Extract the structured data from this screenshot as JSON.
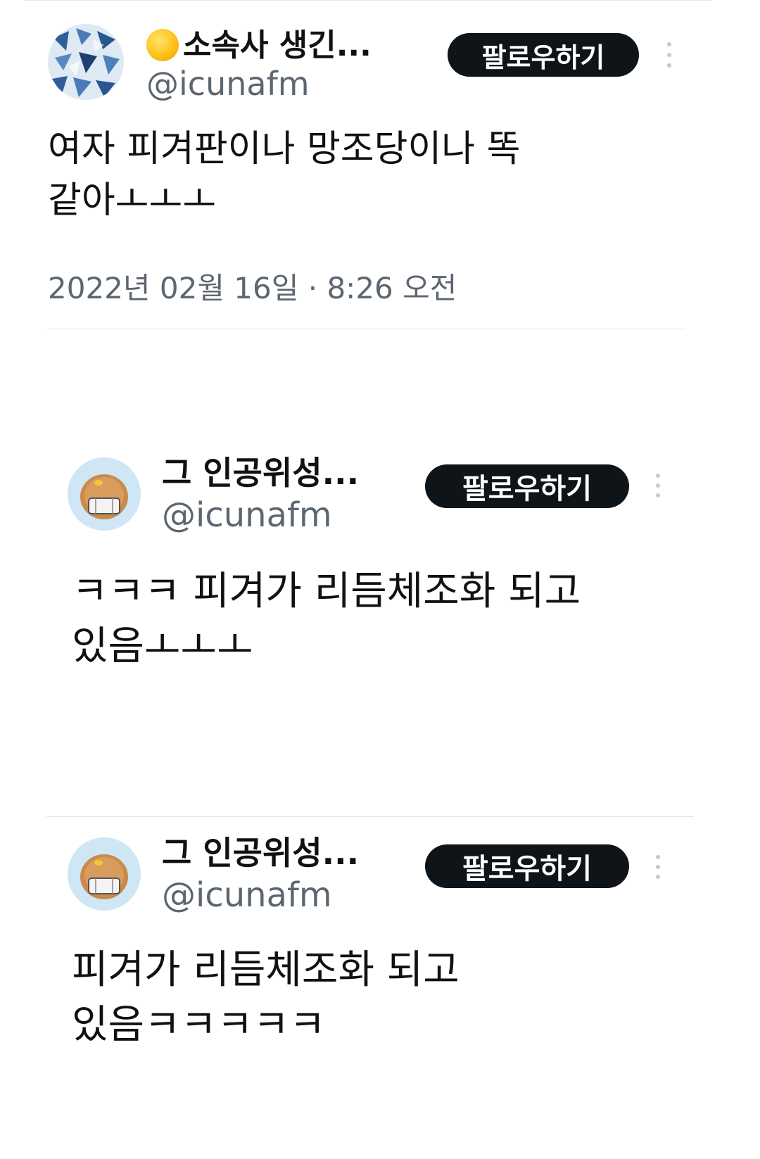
{
  "posts": [
    {
      "name": "소속사 생긴...",
      "handle": "@icunafm",
      "follow_label": "팔로우하기",
      "text_lines": [
        "여자 피겨판이나 망조당이나 똑",
        "같아ㅗㅗㅗ"
      ],
      "timestamp": "2022년 02월 16일 · 8:26 오전",
      "avatar_icon": "blue-patterned-avatar",
      "name_prefix_icon": "yellow-moon-emoji-icon"
    },
    {
      "name": "그 인공위성...",
      "handle": "@icunafm",
      "follow_label": "팔로우하기",
      "text_lines": [
        "ㅋㅋㅋ 피겨가 리듬체조화 되고",
        "있음ㅗㅗㅗ"
      ],
      "avatar_icon": "bread-character-avatar"
    },
    {
      "name": "그 인공위성...",
      "handle": "@icunafm",
      "follow_label": "팔로우하기",
      "text_lines": [
        "피겨가 리듬체조화 되고",
        "있음ㅋㅋㅋㅋㅋ"
      ],
      "avatar_icon": "bread-character-avatar"
    }
  ],
  "colors": {
    "follow_bg": "#0f1419",
    "handle": "#5b6670",
    "divider": "#e4e6e8"
  }
}
